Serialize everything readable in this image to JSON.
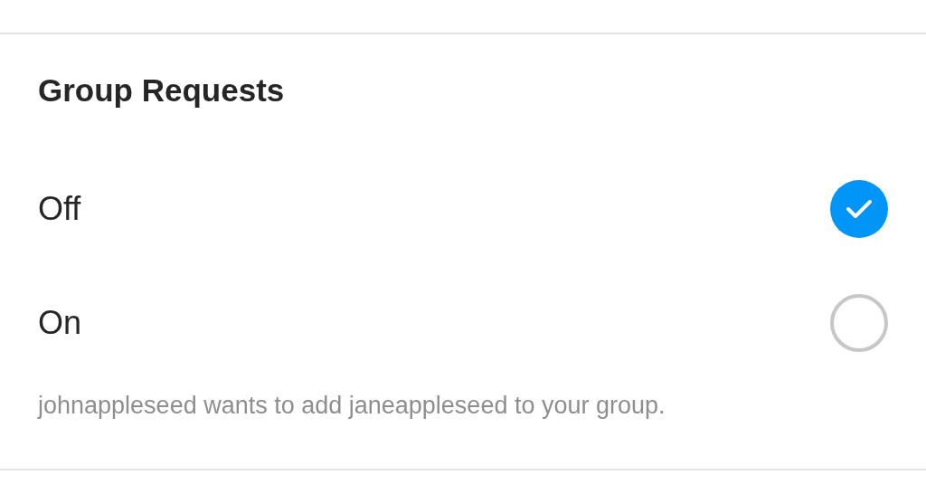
{
  "section": {
    "title": "Group Requests"
  },
  "options": [
    {
      "label": "Off",
      "selected": true
    },
    {
      "label": "On",
      "selected": false
    }
  ],
  "note": "johnappleseed wants to add janeappleseed to your group."
}
